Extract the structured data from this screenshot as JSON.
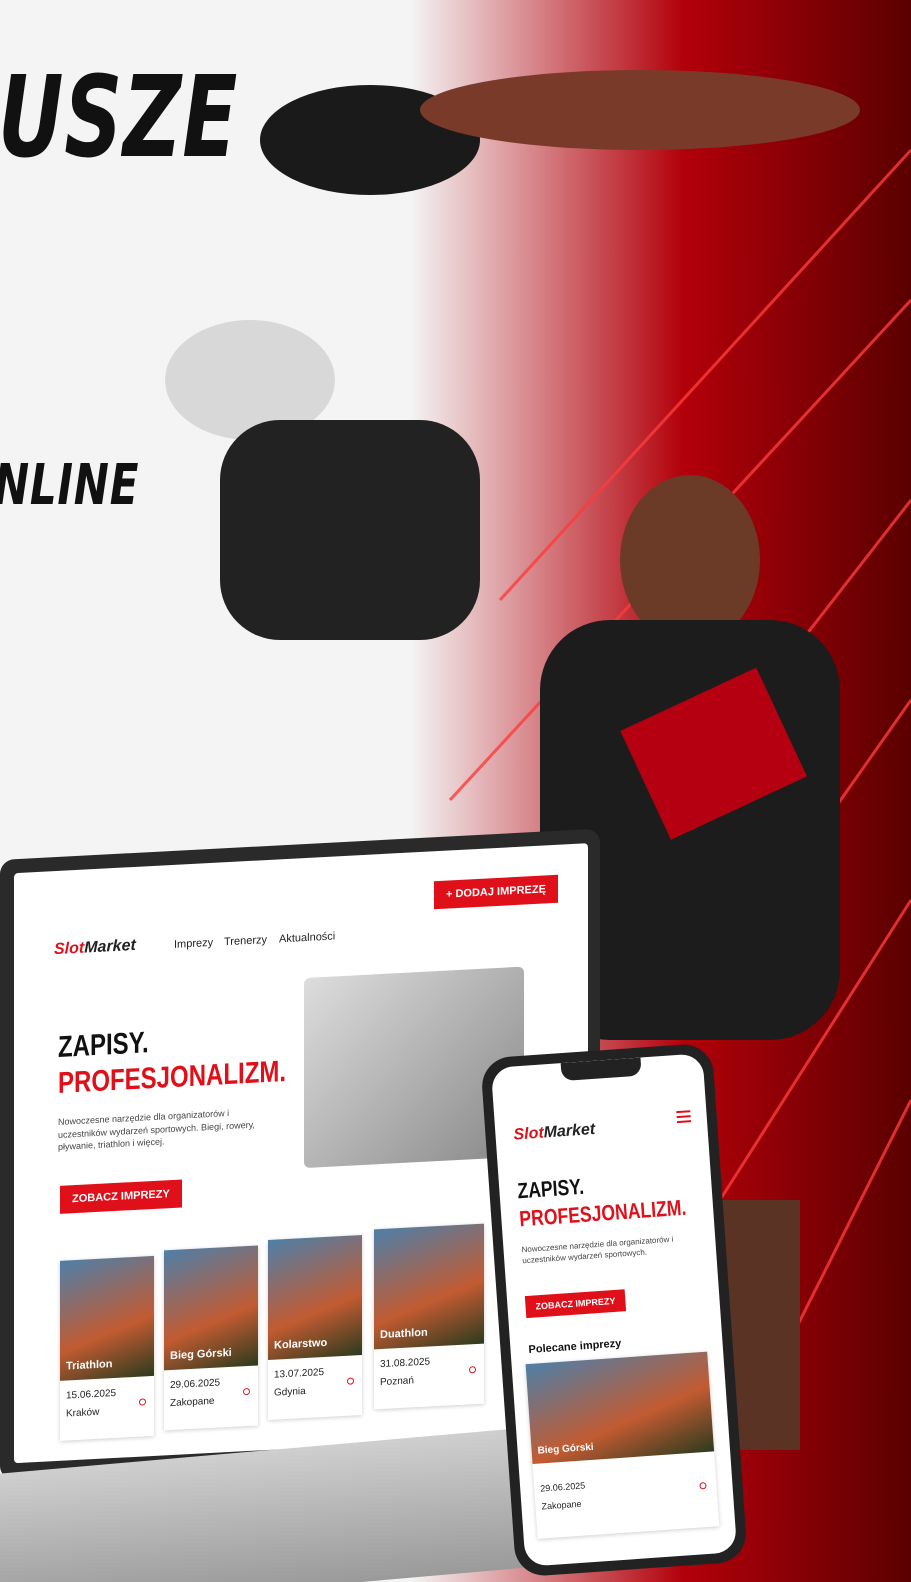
{
  "headline": {
    "line1": "USZE",
    "line2": "NLINE"
  },
  "laptop": {
    "logo_red": "Slot",
    "logo_dark": "Market",
    "nav": [
      "Imprezy",
      "Trenerzy",
      "Aktualności"
    ],
    "add_button": "+ DODAJ IMPREZĘ",
    "hero_line1": "ZAPISY.",
    "hero_line2": "PROFESJONALIZM.",
    "description": "Nowoczesne narzędzie dla organizatorów i uczestników wydarzeń sportowych. Biegi, rowery, pływanie, triathlon i więcej.",
    "see_button": "ZOBACZ IMPREZY",
    "cards": [
      {
        "name": "Triathlon",
        "date": "15.06.2025",
        "city": "Kraków"
      },
      {
        "name": "Bieg Górski",
        "date": "29.06.2025",
        "city": "Zakopane"
      },
      {
        "name": "Kolarstwo",
        "date": "13.07.2025",
        "city": "Gdynia"
      },
      {
        "name": "Duathlon",
        "date": "31.08.2025",
        "city": "Poznań"
      }
    ]
  },
  "phone": {
    "logo_red": "Slot",
    "logo_dark": "Market",
    "hero_line1": "ZAPISY.",
    "hero_line2": "PROFESJONALIZM.",
    "description": "Nowoczesne narzędzie dla organizatorów i uczestników wydarzeń sportowych.",
    "see_button": "ZOBACZ IMPREZY",
    "section_title": "Polecane imprezy",
    "card": {
      "name": "Bieg Górski",
      "date": "29.06.2025",
      "city": "Zakopane"
    }
  },
  "colors": {
    "brand": "#e0101a",
    "dark": "#111111"
  }
}
